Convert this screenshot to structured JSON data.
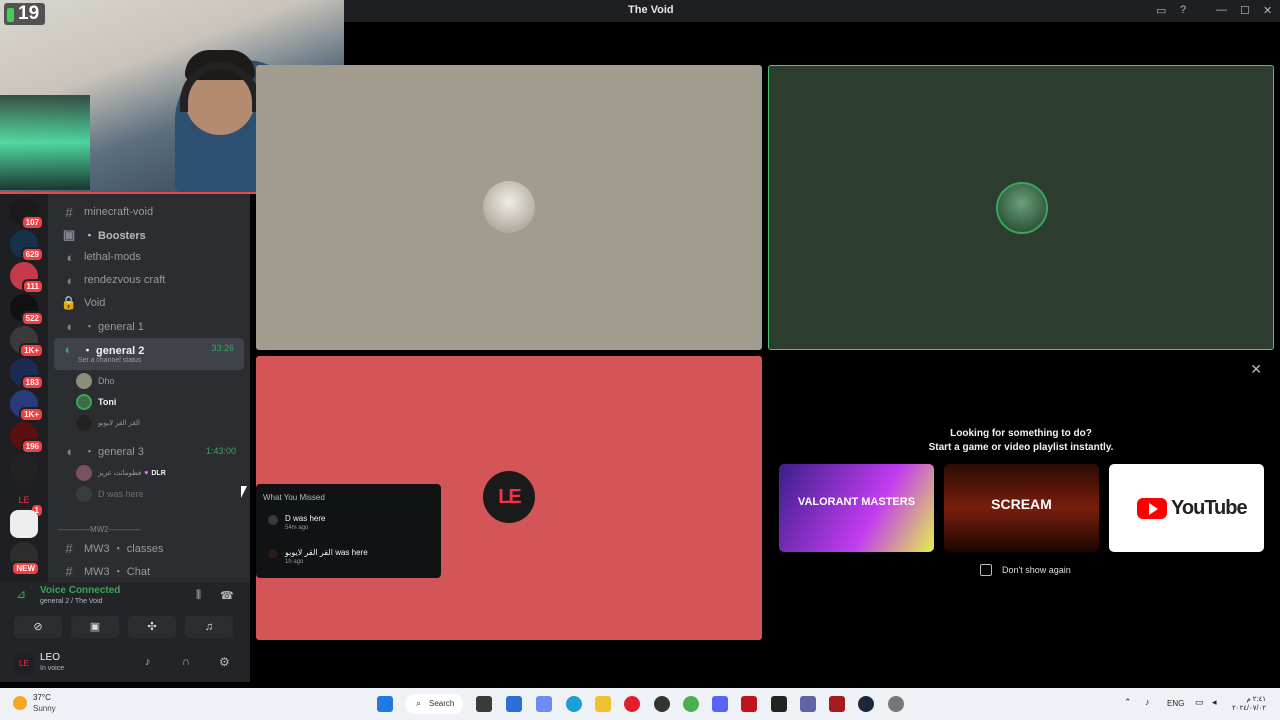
{
  "window": {
    "title": "The Void"
  },
  "webcam": {
    "badge": "19"
  },
  "servers": [
    {
      "label": "",
      "count": "107"
    },
    {
      "label": "",
      "count": "629"
    },
    {
      "label": "",
      "count": "111"
    },
    {
      "label": "",
      "count": "522"
    },
    {
      "label": "",
      "count": "1K+"
    },
    {
      "label": "",
      "count": "183"
    },
    {
      "label": "",
      "count": "1K+"
    },
    {
      "label": "",
      "count": "196"
    },
    {
      "label": "",
      "count": ""
    },
    {
      "label": "",
      "count": "1"
    },
    {
      "label": "",
      "count": ""
    },
    {
      "label": "",
      "count": "NEW"
    }
  ],
  "channels": {
    "minecraft": "minecraft-void",
    "boosters": "・ Boosters",
    "lethal": "lethal-mods",
    "rendezvous": "rendezvous craft",
    "void": "Void",
    "general1": "・ general 1",
    "general2": "・ general 2",
    "general2_time": "33:26",
    "general2_status": "Set a channel status",
    "general3": "・ general 3",
    "general3_time": "1:43:00",
    "category_mw2": "------------MW2------------",
    "mw3_classes": "MW3 ・ classes",
    "mw3_chat": "MW3 ・ Chat"
  },
  "voice_users": {
    "general2": [
      "Dho",
      "Toni",
      "القر القر لايوبو"
    ],
    "general3": [
      "فطوماتت عزيز",
      "DLR",
      "D was here"
    ]
  },
  "voice_panel": {
    "status": "Voice Connected",
    "location": "general 2 / The Void",
    "username": "LEO",
    "user_status": "In voice"
  },
  "activity": {
    "heading1": "Looking for something to do?",
    "heading2": "Start a game or video playlist instantly.",
    "cards": [
      "VALORANT MASTERS",
      "SCREAM",
      "YouTube"
    ],
    "dont_show": "Don't show again"
  },
  "popup": {
    "title": "What You Missed",
    "items": [
      {
        "text": "D was here",
        "time": "54m ago"
      },
      {
        "text": "القر القر لايوبو was here",
        "time": "1h ago"
      }
    ]
  },
  "tile3": {
    "logo": "LE"
  },
  "taskbar": {
    "temp": "37°C",
    "weather": "Sunny",
    "search": "Search",
    "lang": "ENG",
    "time": "٢:٤١ م",
    "date": "٢٠٢٤/٠٧/٠٢"
  }
}
